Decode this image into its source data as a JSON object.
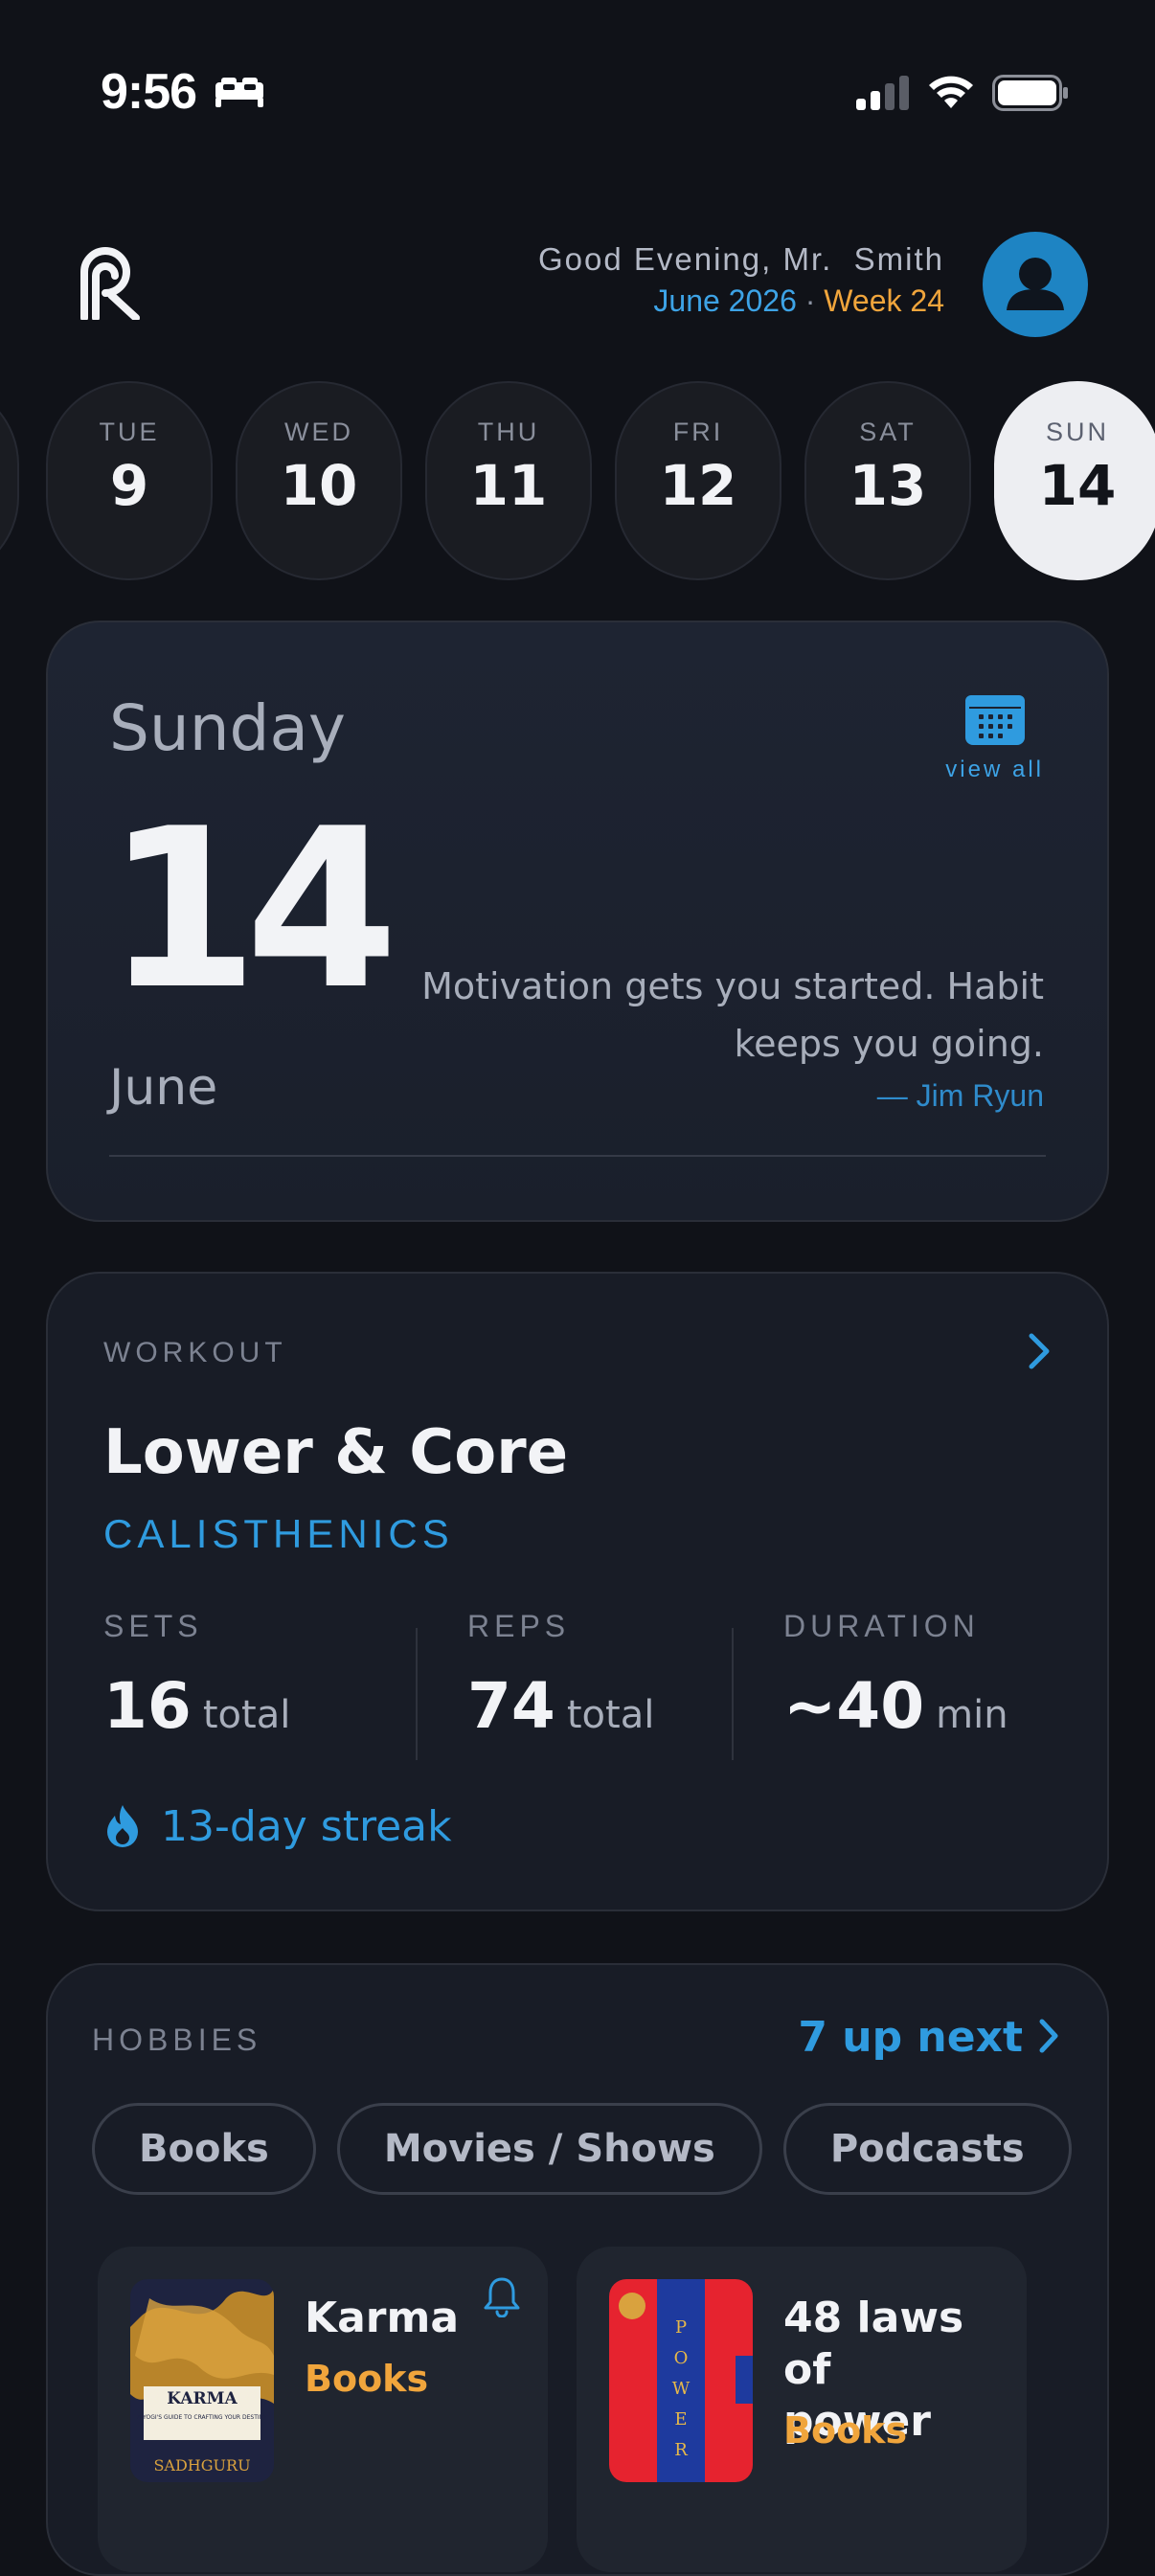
{
  "status_bar": {
    "time": "9:56",
    "icons": [
      "bed-icon",
      "cellular-signal-icon",
      "wifi-icon",
      "battery-icon"
    ]
  },
  "header": {
    "greeting": "Good Evening, Mr.  Smith",
    "month_year": "June 2026",
    "separator": " · ",
    "week": "Week 24",
    "logo_icon": "app-logo-icon",
    "avatar_icon": "user-avatar-icon"
  },
  "day_strip": {
    "days": [
      {
        "dow": "TUE",
        "num": "9"
      },
      {
        "dow": "WED",
        "num": "10"
      },
      {
        "dow": "THU",
        "num": "11"
      },
      {
        "dow": "FRI",
        "num": "12"
      },
      {
        "dow": "SAT",
        "num": "13"
      },
      {
        "dow": "SUN",
        "num": "14",
        "active": true
      }
    ]
  },
  "date_card": {
    "weekday": "Sunday",
    "day": "14",
    "month": "June",
    "view_all_label": "view all",
    "calendar_icon": "calendar-icon",
    "quote": "Motivation gets you started. Habit keeps you going.",
    "author": "— Jim Ryun"
  },
  "workout": {
    "section_label": "WORKOUT",
    "title": "Lower & Core",
    "type": "CALISTHENICS",
    "stats": [
      {
        "label": "SETS",
        "value": "16",
        "unit": "total"
      },
      {
        "label": "REPS",
        "value": "74",
        "unit": "total"
      },
      {
        "label": "DURATION",
        "value": "~40",
        "unit": "min"
      }
    ],
    "streak": "13-day streak",
    "streak_icon": "flame-icon"
  },
  "hobbies": {
    "section_label": "HOBBIES",
    "up_next": "7 up next",
    "chips": [
      "Books",
      "Movies / Shows",
      "Podcasts"
    ],
    "items": [
      {
        "title": "Karma",
        "category": "Books",
        "cover": {
          "title": "KARMA",
          "subtitle": "A YOGI'S GUIDE TO CRAFTING YOUR DESTINY",
          "author": "SADHGURU"
        },
        "has_bell": true
      },
      {
        "title": "48 laws of power",
        "category": "Books",
        "cover": {
          "title": "POWER"
        },
        "has_bell": false
      }
    ]
  },
  "colors": {
    "background": "#101218",
    "accent_blue": "#2F9BDF",
    "accent_orange": "#F0A53C",
    "card": "#181C26",
    "active_day": "#EDEEF2"
  }
}
